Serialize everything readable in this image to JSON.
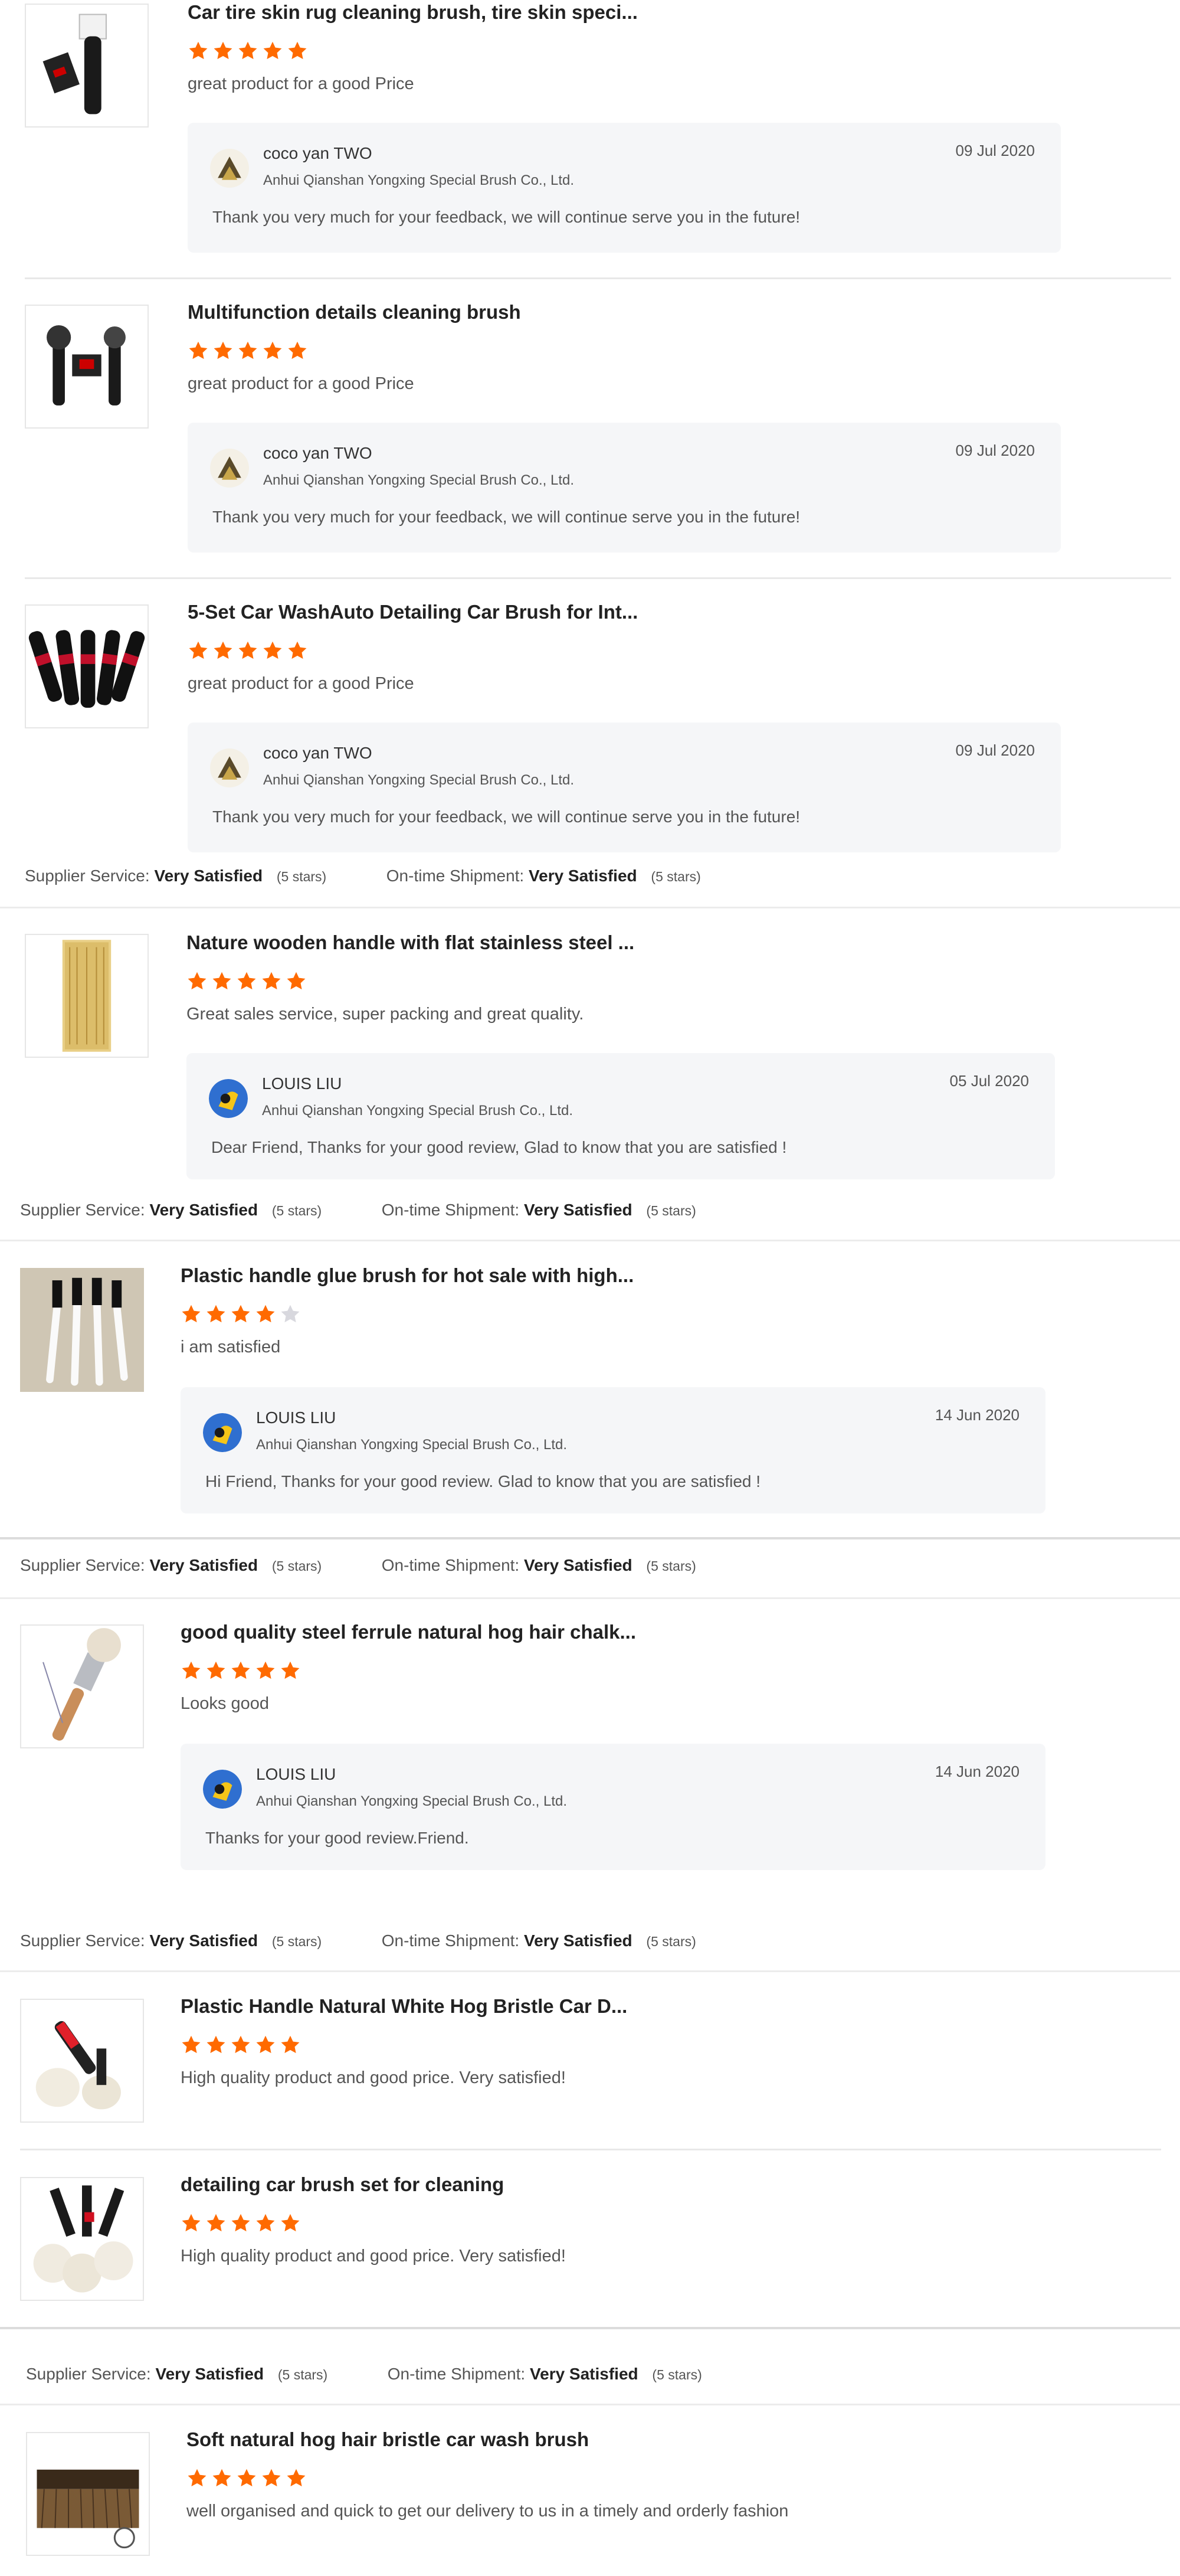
{
  "reviews": [
    {
      "title": "Car tire skin rug cleaning brush, tire skin speci...",
      "rating": 5,
      "text": "great product for a good Price",
      "reply": {
        "name": "coco yan TWO",
        "company": "Anhui Qianshan Yongxing Special Brush Co., Ltd.",
        "date": "09 Jul 2020",
        "message": "Thank you very much for your feedback, we will continue serve you in the future!"
      }
    },
    {
      "title": "Multifunction details cleaning brush",
      "rating": 5,
      "text": "great product for a good Price",
      "reply": {
        "name": "coco yan TWO",
        "company": "Anhui Qianshan Yongxing Special Brush Co., Ltd.",
        "date": "09 Jul 2020",
        "message": "Thank you very much for your feedback, we will continue serve you in the future!"
      }
    },
    {
      "title": "5-Set Car WashAuto Detailing Car Brush for Int...",
      "rating": 5,
      "text": "great product for a good Price",
      "reply": {
        "name": "coco yan TWO",
        "company": "Anhui Qianshan Yongxing Special Brush Co., Ltd.",
        "date": "09 Jul 2020",
        "message": "Thank you very much for your feedback, we will continue serve you in the future!"
      }
    },
    {
      "title": "Nature wooden handle with flat stainless steel ...",
      "rating": 5,
      "text": "Great sales service, super packing and great quality.",
      "reply": {
        "name": "LOUIS LIU",
        "company": "Anhui Qianshan Yongxing Special Brush Co., Ltd.",
        "date": "05 Jul 2020",
        "message": "Dear Friend, Thanks for your good review, Glad to know that you are satisfied !"
      }
    },
    {
      "title": "Plastic handle glue brush for hot sale with high...",
      "rating": 4,
      "text": "i am satisfied",
      "reply": {
        "name": "LOUIS LIU",
        "company": "Anhui Qianshan Yongxing Special Brush Co., Ltd.",
        "date": "14 Jun 2020",
        "message": "Hi Friend, Thanks for your good review. Glad to know that you are satisfied !"
      }
    },
    {
      "title": "good quality steel ferrule natural hog hair chalk...",
      "rating": 5,
      "text": "Looks good",
      "reply": {
        "name": "LOUIS LIU",
        "company": "Anhui Qianshan Yongxing Special Brush Co., Ltd.",
        "date": "14 Jun 2020",
        "message": "Thanks for your good review.Friend."
      }
    },
    {
      "title": "Plastic Handle Natural White Hog Bristle Car D...",
      "rating": 5,
      "text": "High quality product and good price. Very satisfied!"
    },
    {
      "title": "detailing car brush set for cleaning",
      "rating": 5,
      "text": "High quality product and good price. Very satisfied!"
    },
    {
      "title": "Soft natural hog hair bristle car wash brush",
      "rating": 5,
      "text": "well organised and quick to get our delivery to us in a timely and orderly fashion"
    }
  ],
  "service_lines": [
    {
      "supplier_label": "Supplier Service:",
      "supplier_value": "Very Satisfied",
      "supplier_stars": "(5 stars)",
      "shipment_label": "On-time Shipment:",
      "shipment_value": "Very Satisfied",
      "shipment_stars": "(5 stars)"
    },
    {
      "supplier_label": "Supplier Service:",
      "supplier_value": "Very Satisfied",
      "supplier_stars": "(5 stars)",
      "shipment_label": "On-time Shipment:",
      "shipment_value": "Very Satisfied",
      "shipment_stars": "(5 stars)"
    },
    {
      "supplier_label": "Supplier Service:",
      "supplier_value": "Very Satisfied",
      "supplier_stars": "(5 stars)",
      "shipment_label": "On-time Shipment:",
      "shipment_value": "Very Satisfied",
      "shipment_stars": "(5 stars)"
    },
    {
      "supplier_label": "Supplier Service:",
      "supplier_value": "Very Satisfied",
      "supplier_stars": "(5 stars)",
      "shipment_label": "On-time Shipment:",
      "shipment_value": "Very Satisfied",
      "shipment_stars": "(5 stars)"
    },
    {
      "supplier_label": "Supplier Service:",
      "supplier_value": "Very Satisfied",
      "supplier_stars": "(5 stars)",
      "shipment_label": "On-time Shipment:",
      "shipment_value": "Very Satisfied",
      "shipment_stars": "(5 stars)"
    }
  ],
  "colors": {
    "star_filled": "#ff6a00",
    "star_empty": "#d8d8de",
    "reply_background": "#f5f6f8"
  },
  "icons": {
    "star": "star-icon",
    "avatar_coco": "coco-yan-avatar",
    "avatar_louis": "louis-liu-avatar"
  }
}
